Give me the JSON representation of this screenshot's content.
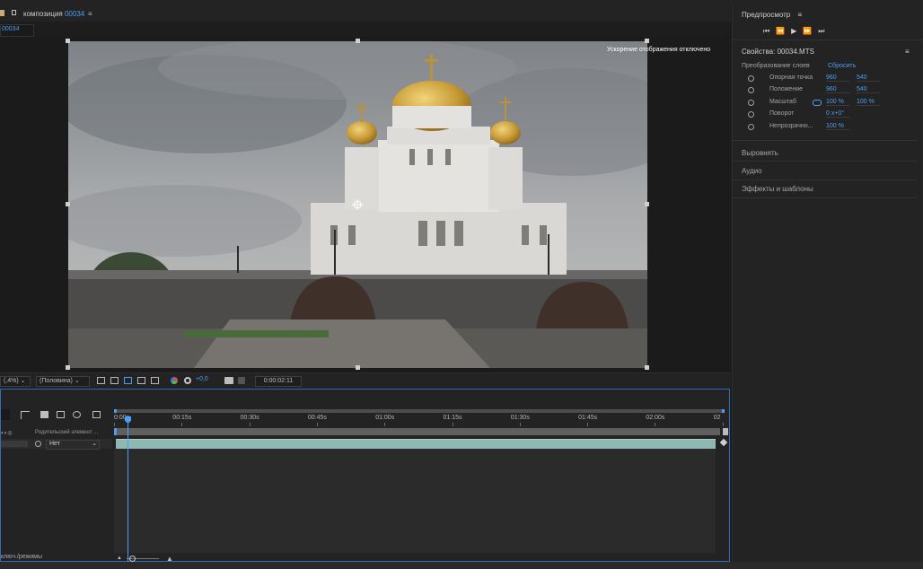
{
  "top_strip": {
    "items": [
      "",
      "",
      ""
    ]
  },
  "composition_panel": {
    "title_prefix": "композиция",
    "title_number": "00034",
    "tab_label": "00034",
    "overlay_text": "Ускорение отображения отключено"
  },
  "viewer_toolbar": {
    "zoom": "(,4%)",
    "resolution": "(Половина)",
    "exposure": "+0,0",
    "timecode": "0:00:02:11"
  },
  "preview_panel": {
    "title": "Предпросмотр"
  },
  "properties_panel": {
    "title": "Свойства: 00034.MTS",
    "section": "Преобразование слоев",
    "reset": "Сбросить",
    "rows": [
      {
        "label": "Опорная точка",
        "v1": "960",
        "v2": "540"
      },
      {
        "label": "Положение",
        "v1": "960",
        "v2": "540"
      },
      {
        "label": "Масштаб",
        "v1": "100 %",
        "v2": "100 %"
      },
      {
        "label": "Поворот",
        "v1": "0 x+0°",
        "v2": ""
      },
      {
        "label": "Непрозрачно...",
        "v1": "100 %",
        "v2": ""
      }
    ],
    "sections": [
      "Выровнять",
      "Аудио",
      "Эффекты и шаблоны"
    ]
  },
  "timeline": {
    "parent_label": "Родительский элемент ...",
    "parent_value": "Нет",
    "ruler": [
      "0:00s",
      "00:15s",
      "00:30s",
      "00:45s",
      "01:00s",
      "01:15s",
      "01:30s",
      "01:45s",
      "02:00s",
      "02"
    ],
    "bottom_label": "ключ./режимы"
  },
  "colors": {
    "accent": "#4a9ff5",
    "clip": "#8fb7b4",
    "work_area": "#5f5f5f"
  }
}
